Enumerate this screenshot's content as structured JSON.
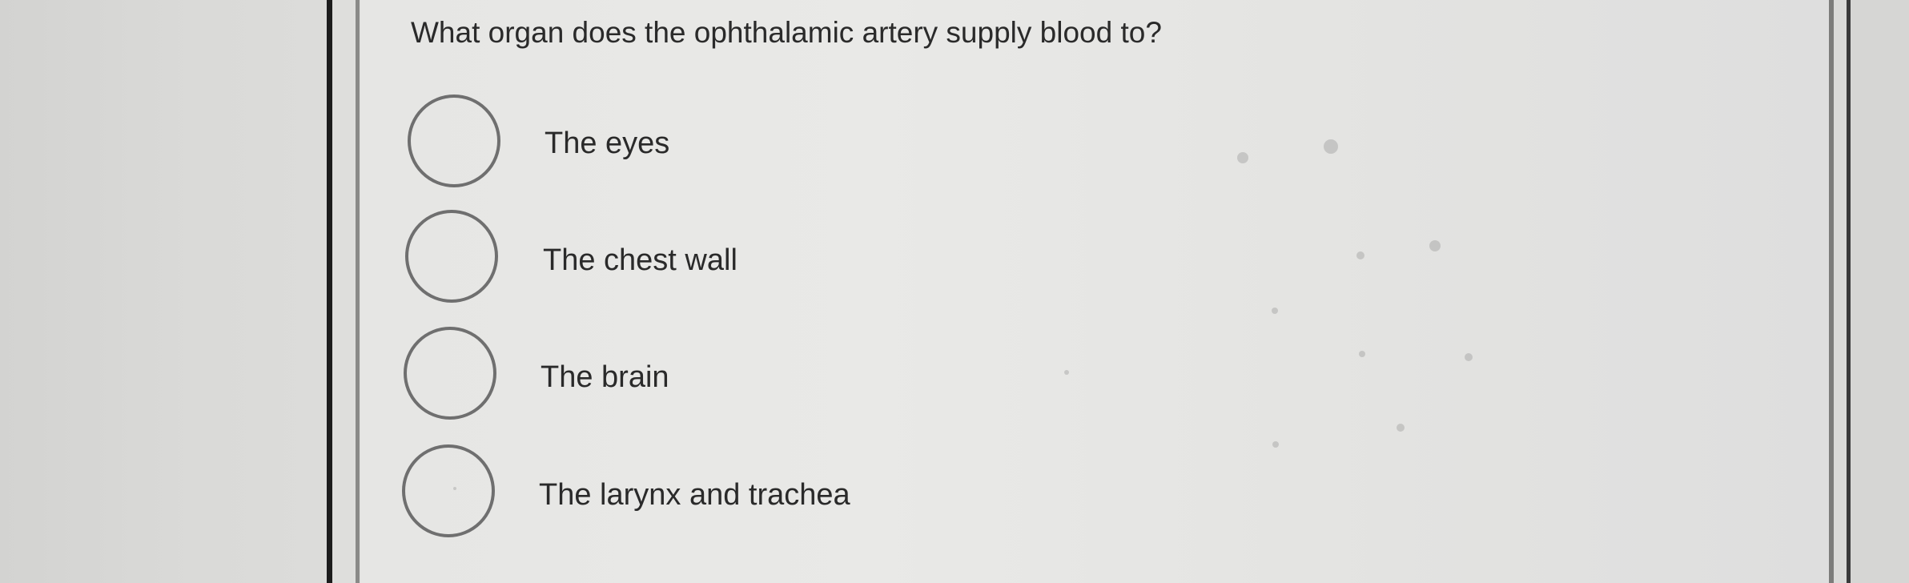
{
  "quiz": {
    "question": "What organ does the ophthalamic artery supply blood to?",
    "options": [
      {
        "label": "The eyes",
        "selected": false
      },
      {
        "label": "The chest wall",
        "selected": false
      },
      {
        "label": "The brain",
        "selected": false
      },
      {
        "label": "The larynx and trachea",
        "selected": false
      }
    ]
  }
}
